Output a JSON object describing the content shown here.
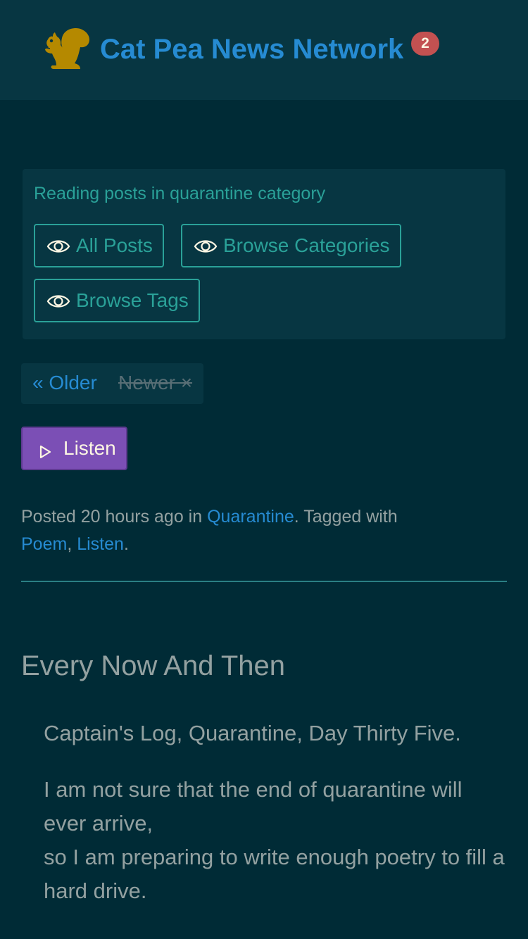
{
  "header": {
    "site_title": "Cat Pea News Network",
    "notification_count": "2",
    "logo_icon": "squirrel-icon",
    "logo_color": "#b58900"
  },
  "category_panel": {
    "heading": "Reading posts in quarantine category",
    "buttons": [
      {
        "label": "All Posts",
        "icon": "eye-icon"
      },
      {
        "label": "Browse Categories",
        "icon": "eye-icon"
      },
      {
        "label": "Browse Tags",
        "icon": "eye-icon"
      }
    ]
  },
  "pager": {
    "older": "« Older",
    "newer": "Newer ×"
  },
  "listen": {
    "label": "Listen",
    "icon": "play-icon",
    "color": "#7b4fb5"
  },
  "meta": {
    "posted": "Posted 20 hours ago in",
    "category": "Quarantine",
    "tagged": ". Tagged with",
    "tags": [
      "Poem",
      "Listen"
    ],
    "separator": ",",
    "end": "."
  },
  "post": {
    "title": "Every Now And Then",
    "paragraphs": [
      [
        "Captain's Log, Quarantine, Day Thirty Five."
      ],
      [
        "I am not sure that the end of quarantine will ever arrive,",
        "so I am preparing to write enough poetry to fill a hard drive."
      ]
    ]
  },
  "colors": {
    "background": "#002b36",
    "header_bg": "#073642",
    "link": "#268bd2",
    "accent": "#2aa198",
    "badge": "#c35151",
    "text": "#93a1a1"
  }
}
